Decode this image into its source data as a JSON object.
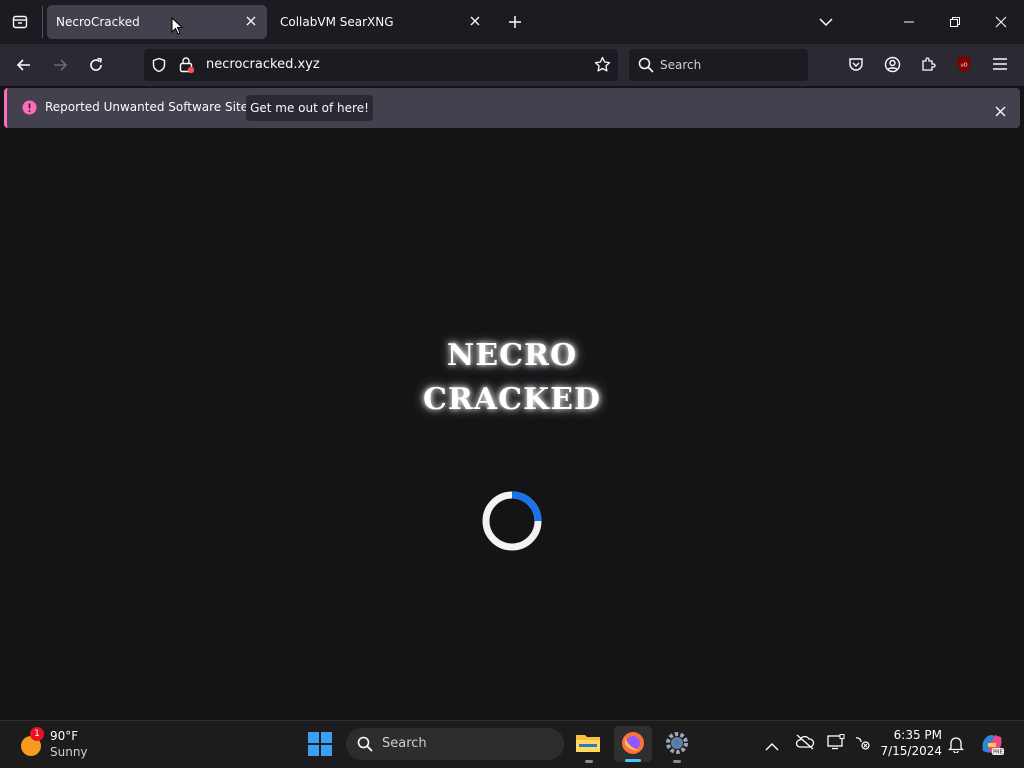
{
  "browser": {
    "tabs": [
      {
        "title": "NecroCracked",
        "active": true
      },
      {
        "title": "CollabVM SearXNG",
        "active": false
      }
    ],
    "url": "necrocracked.xyz",
    "search_placeholder": "Search",
    "notification": {
      "message": "Reported Unwanted Software Site!",
      "button_label": "Get me out of here!"
    }
  },
  "page": {
    "logo_line1": "NECRO",
    "logo_line2": "CRACKED",
    "loading_spinner_color": "#1a73e8"
  },
  "taskbar": {
    "weather": {
      "badge": "1",
      "temperature": "90°F",
      "condition": "Sunny"
    },
    "search_placeholder": "Search",
    "clock": {
      "time": "6:35 PM",
      "date": "7/15/2024"
    }
  },
  "colors": {
    "tab_strip": "#1c1b22",
    "nav_bar": "#2b2a33",
    "notification_accent": "#ff6bba",
    "page_background": "#141316",
    "taskbar": "#1c1c1c"
  }
}
